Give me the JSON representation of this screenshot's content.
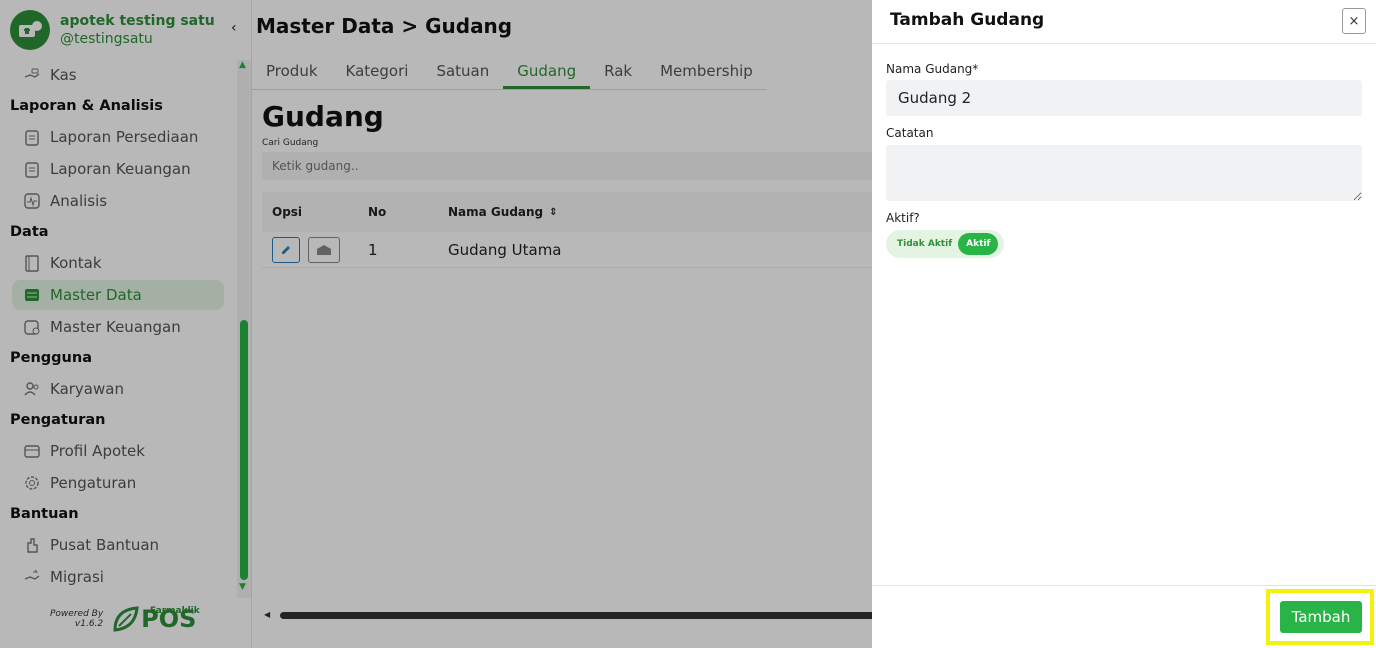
{
  "brand": {
    "name": "apotek testing satu",
    "handle": "@testingsatu"
  },
  "sidebar": {
    "sections": [
      {
        "title": "",
        "items": [
          {
            "label": "Kas",
            "icon": "cash-hand-icon"
          }
        ]
      },
      {
        "title": "Laporan & Analisis",
        "items": [
          {
            "label": "Laporan Persediaan",
            "icon": "clipboard-icon"
          },
          {
            "label": "Laporan Keuangan",
            "icon": "clipboard-icon"
          },
          {
            "label": "Analisis",
            "icon": "chart-pulse-icon"
          }
        ]
      },
      {
        "title": "Data",
        "items": [
          {
            "label": "Kontak",
            "icon": "contact-book-icon"
          },
          {
            "label": "Master Data",
            "icon": "database-icon",
            "active": true
          },
          {
            "label": "Master Keuangan",
            "icon": "finance-icon"
          }
        ]
      },
      {
        "title": "Pengguna",
        "items": [
          {
            "label": "Karyawan",
            "icon": "users-icon"
          }
        ]
      },
      {
        "title": "Pengaturan",
        "items": [
          {
            "label": "Profil Apotek",
            "icon": "store-icon"
          },
          {
            "label": "Pengaturan",
            "icon": "gear-icon"
          }
        ]
      },
      {
        "title": "Bantuan",
        "items": [
          {
            "label": "Pusat Bantuan",
            "icon": "help-hand-icon"
          },
          {
            "label": "Migrasi",
            "icon": "migrate-icon"
          }
        ]
      }
    ],
    "powered_by": "Powered By",
    "version": "v1.6.2",
    "pos_brand": "Farmaklik",
    "pos_word": "POS"
  },
  "header": {
    "breadcrumb": "Master Data > Gudang"
  },
  "tabs": [
    "Produk",
    "Kategori",
    "Satuan",
    "Gudang",
    "Rak",
    "Membership"
  ],
  "active_tab": "Gudang",
  "content": {
    "title": "Gudang",
    "search_label": "Cari Gudang",
    "search_placeholder": "Ketik gudang..",
    "columns": [
      "Opsi",
      "No",
      "Nama Gudang"
    ],
    "rows": [
      {
        "no": "1",
        "name": "Gudang Utama"
      }
    ]
  },
  "drawer": {
    "title": "Tambah Gudang",
    "name_label": "Nama Gudang*",
    "name_value": "Gudang 2",
    "note_label": "Catatan",
    "note_value": "",
    "active_label": "Aktif?",
    "toggle_off": "Tidak Aktif",
    "toggle_on": "Aktif",
    "submit": "Tambah",
    "close": "×"
  },
  "colors": {
    "primary": "#28b446",
    "brand": "#2f8f3a",
    "highlight": "#f4f10a"
  }
}
